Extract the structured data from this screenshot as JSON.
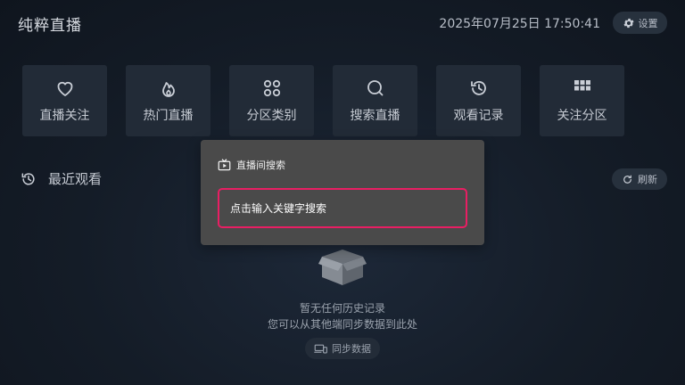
{
  "header": {
    "app_title": "纯粹直播",
    "datetime": "2025年07月25日 17:50:41",
    "settings_label": "设置"
  },
  "tiles": [
    {
      "label": "直播关注",
      "icon": "heart-icon"
    },
    {
      "label": "热门直播",
      "icon": "flame-icon"
    },
    {
      "label": "分区类别",
      "icon": "category-grid-icon"
    },
    {
      "label": "搜索直播",
      "icon": "search-icon"
    },
    {
      "label": "观看记录",
      "icon": "history-icon"
    },
    {
      "label": "关注分区",
      "icon": "apps-grid-icon"
    }
  ],
  "recent": {
    "title": "最近观看",
    "refresh_label": "刷新",
    "empty_line1": "暂无任何历史记录",
    "empty_line2": "您可以从其他端同步数据到此处",
    "sync_label": "同步数据"
  },
  "dialog": {
    "title": "直播间搜索",
    "placeholder": "点击输入关键字搜索"
  },
  "colors": {
    "accent": "#e91e63",
    "dialog_bg": "#4a4a4a",
    "tile_bg": "#222b37",
    "page_bg": "#141c27"
  }
}
